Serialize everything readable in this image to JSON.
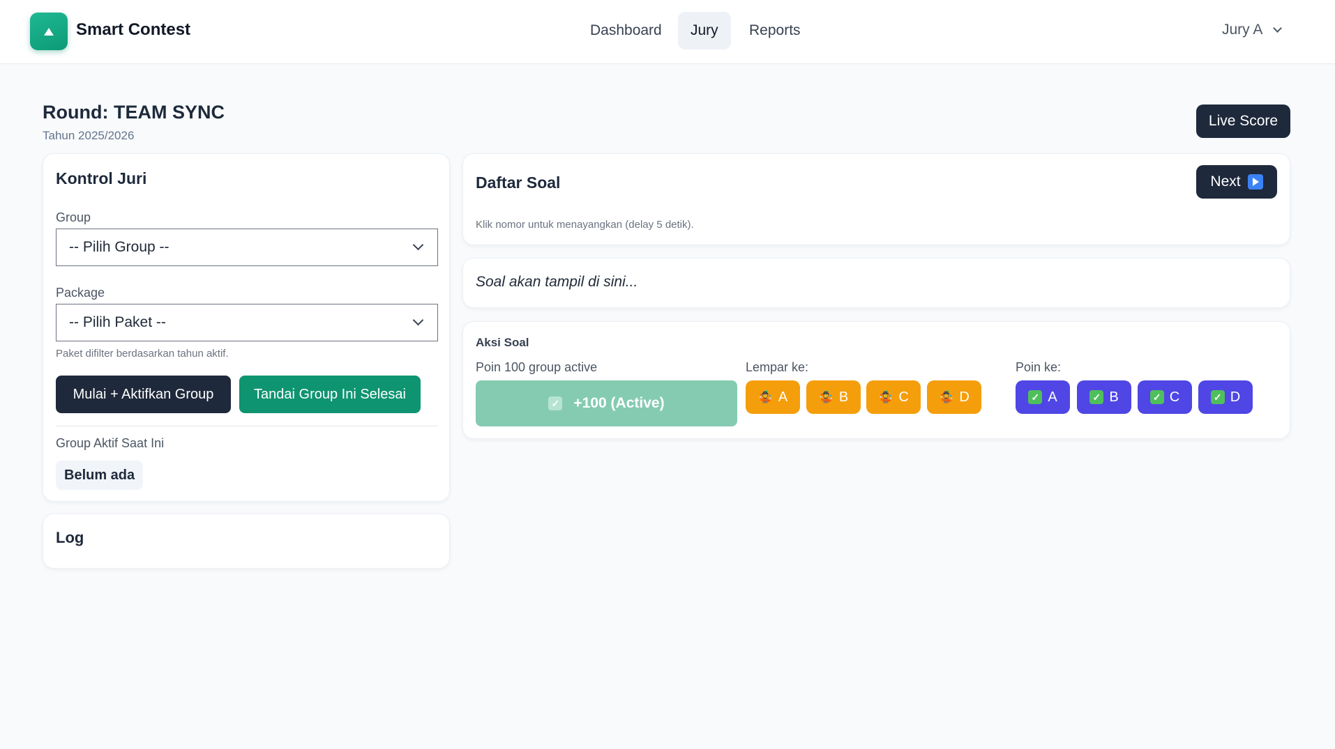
{
  "nav": {
    "brand": "Smart Contest",
    "links": [
      "Dashboard",
      "Jury",
      "Reports"
    ],
    "active_link": "Jury",
    "user": "Jury A"
  },
  "header": {
    "title": "Round: TEAM SYNC",
    "subtitle": "Tahun 2025/2026",
    "live_score_label": "Live Score"
  },
  "kontrol": {
    "title": "Kontrol Juri",
    "group_label": "Group",
    "group_value": "-- Pilih Group --",
    "package_label": "Package",
    "package_value": "-- Pilih Paket --",
    "package_help": "Paket difilter berdasarkan tahun aktif.",
    "start_button": "Mulai + Aktifkan Group",
    "finish_button": "Tandai Group Ini Selesai",
    "active_group_label": "Group Aktif Saat Ini",
    "active_group_value": "Belum ada"
  },
  "log": {
    "title": "Log"
  },
  "daftar_soal": {
    "title": "Daftar Soal",
    "next_label": "Next",
    "next_icon": "play-icon",
    "help": "Klik nomor untuk menayangkan (delay 5 detik)."
  },
  "question": {
    "placeholder": "Soal akan tampil di sini..."
  },
  "aksi": {
    "title": "Aksi Soal",
    "points_label": "Poin 100 group active",
    "active_button": "+100 (Active)",
    "throw_label": "Lempar ke:",
    "throw_icon": "juggling-icon",
    "throw_targets": [
      "A",
      "B",
      "C",
      "D"
    ],
    "points_to_label": "Poin ke:",
    "points_icon": "check-box-icon",
    "points_targets": [
      "A",
      "B",
      "C",
      "D"
    ]
  },
  "colors": {
    "dark": "#1e293b",
    "green": "#0e9470",
    "active_disabled": "#84cbb2",
    "orange": "#f59e0b",
    "purple": "#4f46e5"
  }
}
